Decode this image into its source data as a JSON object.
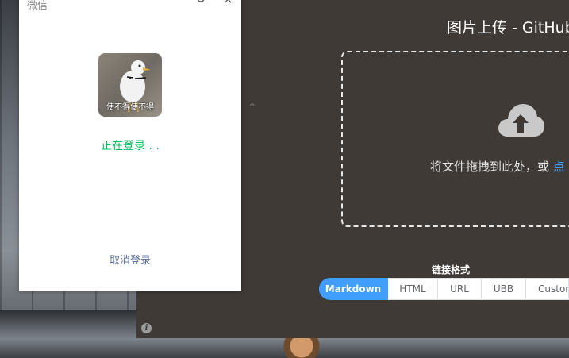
{
  "wechat": {
    "title": "微信",
    "status": "正在登录 . .",
    "cancel_label": "取消登录",
    "avatar_caption": "使不得使不得",
    "status_color": "#07c160",
    "link_color": "#576b95"
  },
  "picgo": {
    "upload_title": "图片上传 - GitHub",
    "drop_text": "将文件拖拽到此处，或 ",
    "drop_link": "点",
    "format_label": "链接格式",
    "formats": [
      {
        "label": "Markdown",
        "active": true
      },
      {
        "label": "HTML",
        "active": false
      },
      {
        "label": "URL",
        "active": false
      },
      {
        "label": "UBB",
        "active": false
      },
      {
        "label": "Custom",
        "active": false
      }
    ],
    "accent": "#409eff",
    "background": "#3f3a36"
  }
}
